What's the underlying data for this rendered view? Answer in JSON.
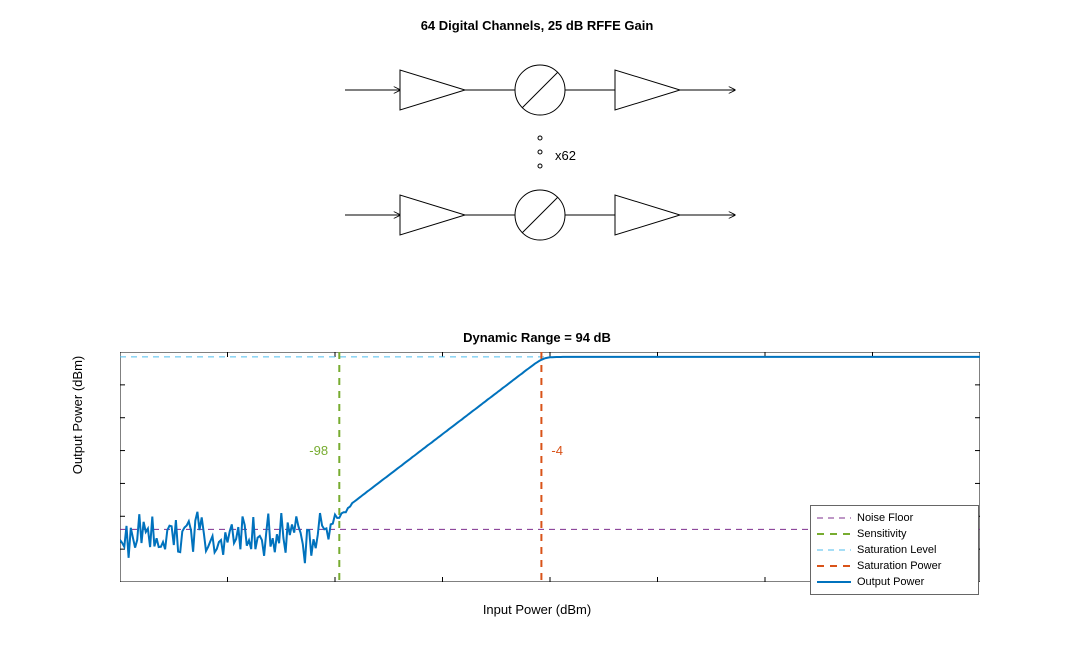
{
  "top": {
    "title": "64 Digital Channels, 25 dB RFFE Gain",
    "repeat_label": "x62"
  },
  "chart_data": {
    "type": "line",
    "title": "Dynamic Range = 94 dB",
    "xlabel": "Input Power (dBm)",
    "ylabel": "Output Power (dBm)",
    "xlim": [
      -200,
      200
    ],
    "ylim": [
      -80,
      60
    ],
    "xticks": [
      -200,
      -150,
      -100,
      -50,
      0,
      50,
      100,
      150,
      200
    ],
    "yticks": [
      -80,
      -60,
      -40,
      -20,
      0,
      20,
      40,
      60
    ],
    "noise_floor": -48,
    "saturation_level": 57,
    "sensitivity": -98,
    "saturation_power": -4,
    "annotations": {
      "sensitivity_label": "-98",
      "saturation_power_label": "-4"
    },
    "gain_db": 60,
    "noise_region": {
      "x_end": -100,
      "amplitude": 14,
      "mean": -52
    },
    "series": [
      {
        "name": "Noise Floor",
        "style": {
          "color": "#7e2f8e",
          "dash": "6,5",
          "width": 1
        }
      },
      {
        "name": "Sensitivity",
        "style": {
          "color": "#77ac30",
          "dash": "7,6",
          "width": 2
        }
      },
      {
        "name": "Saturation Level",
        "style": {
          "color": "#4dbeee",
          "dash": "6,5",
          "width": 1
        }
      },
      {
        "name": "Saturation Power",
        "style": {
          "color": "#d95319",
          "dash": "7,6",
          "width": 2
        }
      },
      {
        "name": "Output Power",
        "style": {
          "color": "#0072bd",
          "dash": "",
          "width": 2
        }
      }
    ]
  },
  "legend": {
    "items": [
      "Noise Floor",
      "Sensitivity",
      "Saturation Level",
      "Saturation Power",
      "Output Power"
    ]
  }
}
